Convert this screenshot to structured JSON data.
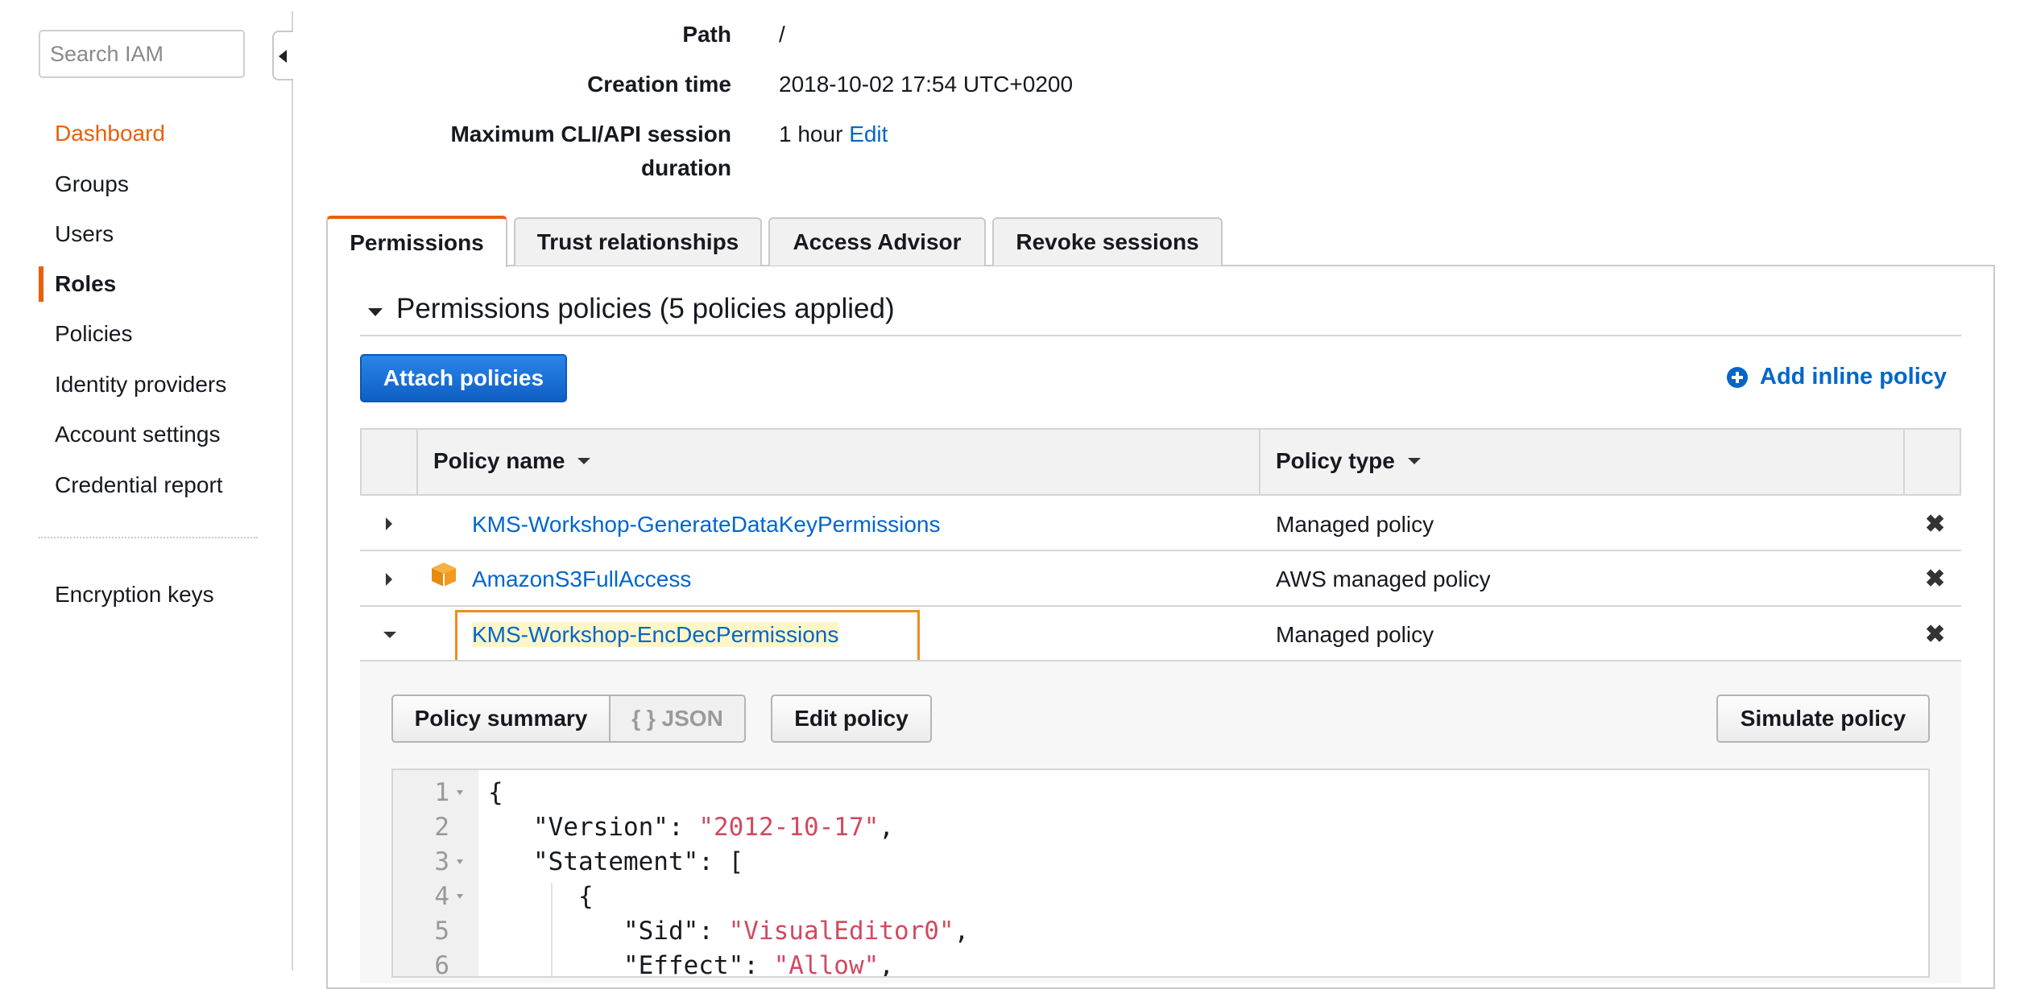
{
  "sidebar": {
    "search_placeholder": "Search IAM",
    "items": [
      {
        "label": "Dashboard"
      },
      {
        "label": "Groups"
      },
      {
        "label": "Users"
      },
      {
        "label": "Roles"
      },
      {
        "label": "Policies"
      },
      {
        "label": "Identity providers"
      },
      {
        "label": "Account settings"
      },
      {
        "label": "Credential report"
      },
      {
        "label": "Encryption keys"
      }
    ]
  },
  "summary": {
    "path_label": "Path",
    "path_value": "/",
    "creation_label": "Creation time",
    "creation_value": "2018-10-02 17:54 UTC+0200",
    "session_label_1": "Maximum CLI/API session",
    "session_label_2": "duration",
    "session_value": "1 hour",
    "session_edit": "Edit"
  },
  "tabs": [
    {
      "label": "Permissions"
    },
    {
      "label": "Trust relationships"
    },
    {
      "label": "Access Advisor"
    },
    {
      "label": "Revoke sessions"
    }
  ],
  "permissions": {
    "title": "Permissions policies (5 policies applied)",
    "attach_button": "Attach policies",
    "add_inline": "Add inline policy",
    "columns": [
      "Policy name",
      "Policy type"
    ],
    "rows": [
      {
        "name": "KMS-Workshop-GenerateDataKeyPermissions",
        "type": "Managed policy"
      },
      {
        "name": "AmazonS3FullAccess",
        "type": "AWS managed policy"
      },
      {
        "name": "KMS-Workshop-EncDecPermissions",
        "type": "Managed policy"
      }
    ],
    "delete_glyph": "✖"
  },
  "policy_detail": {
    "summary_button": "Policy summary",
    "json_button": "{ } JSON",
    "edit_button": "Edit policy",
    "simulate_button": "Simulate policy",
    "line_numbers": [
      "1",
      "2",
      "3",
      "4",
      "5",
      "6"
    ],
    "code": {
      "l1": "{",
      "l2_key": "\"Version\": ",
      "l2_val": "\"2012-10-17\"",
      "l2_end": ",",
      "l3_key": "\"Statement\": ",
      "l3_end": "[",
      "l4": "{",
      "l5_key": "\"Sid\": ",
      "l5_val": "\"VisualEditor0\"",
      "l5_end": ",",
      "l6_key": "\"Effect\": ",
      "l6_val": "\"Allow\"",
      "l6_end": ","
    }
  },
  "colors": {
    "accent_orange": "#eb5f07",
    "link_blue": "#0066cc",
    "primary_button": "#1a73d9",
    "json_string": "#d14a60"
  }
}
